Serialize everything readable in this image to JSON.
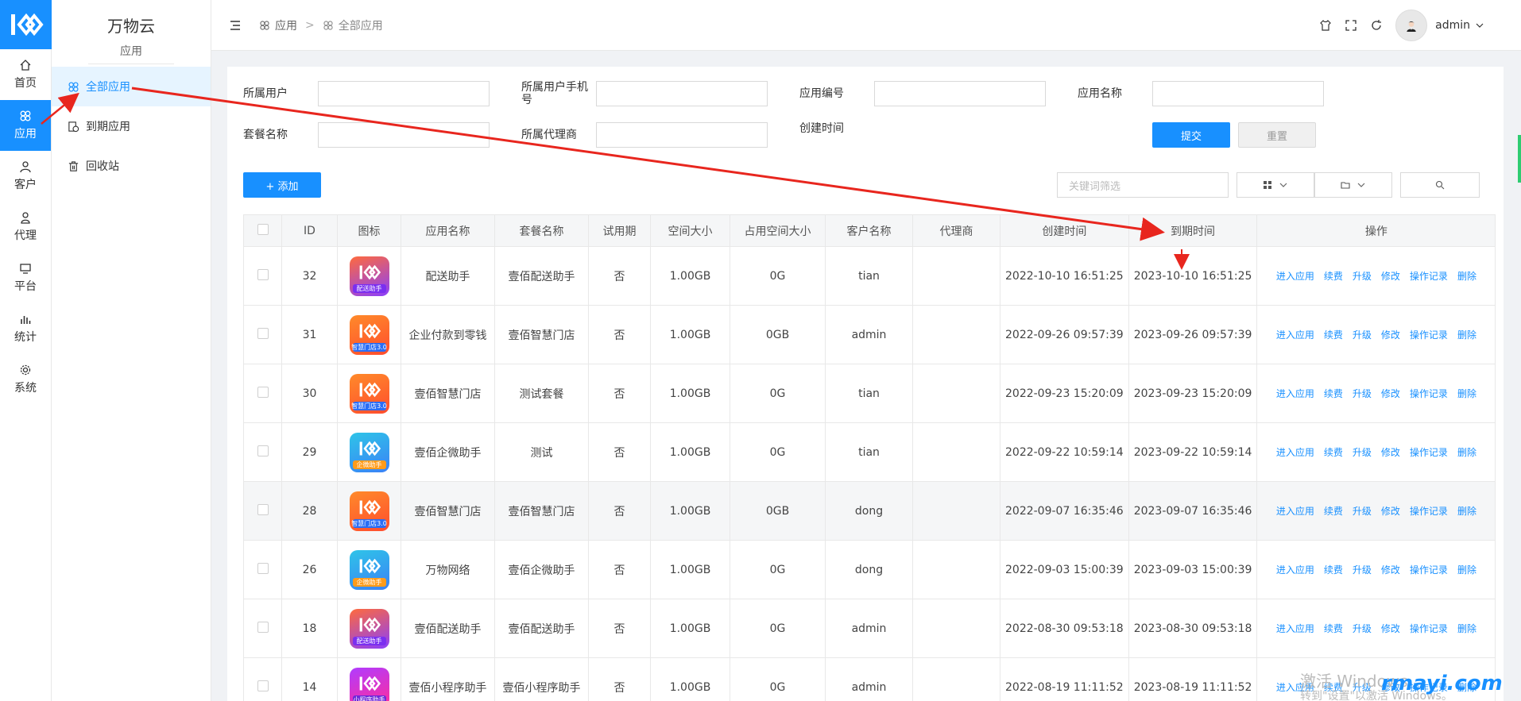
{
  "rail": {
    "items": [
      {
        "label": "首页",
        "icon": "home-icon"
      },
      {
        "label": "应用",
        "icon": "apps-icon"
      },
      {
        "label": "客户",
        "icon": "user-icon"
      },
      {
        "label": "代理",
        "icon": "agent-icon"
      },
      {
        "label": "平台",
        "icon": "platform-icon"
      },
      {
        "label": "统计",
        "icon": "stats-icon"
      },
      {
        "label": "系统",
        "icon": "gear-icon"
      }
    ],
    "active_index": 1
  },
  "submenu": {
    "brand": "万物云",
    "section": "应用",
    "items": [
      {
        "label": "全部应用",
        "icon": "apps-icon"
      },
      {
        "label": "到期应用",
        "icon": "expire-icon"
      },
      {
        "label": "回收站",
        "icon": "trash-icon"
      }
    ],
    "active_index": 0
  },
  "header": {
    "breadcrumb": [
      "应用",
      "全部应用"
    ],
    "separator": ">",
    "user": "admin"
  },
  "filters": {
    "fields": [
      "所属用户",
      "所属用户手机号",
      "应用编号",
      "应用名称",
      "套餐名称",
      "所属代理商",
      "创建时间"
    ],
    "submit_label": "提交",
    "reset_label": "重置"
  },
  "toolbar": {
    "add_label": "+ 添加",
    "search_placeholder": "关键词筛选"
  },
  "table": {
    "columns": [
      "ID",
      "图标",
      "应用名称",
      "套餐名称",
      "试用期",
      "空间大小",
      "占用空间大小",
      "客户名称",
      "代理商",
      "创建时间",
      "到期时间",
      "操作"
    ],
    "actions": [
      "进入应用",
      "续费",
      "升级",
      "修改",
      "操作记录",
      "删除"
    ],
    "rows": [
      {
        "id": "32",
        "icon_tag": "配送助手",
        "icon_color": "purple",
        "name": "配送助手",
        "plan": "壹佰配送助手",
        "trial": "否",
        "space": "1.00GB",
        "used": "0G",
        "customer": "tian",
        "agent": "",
        "created": "2022-10-10 16:51:25",
        "expires": "2023-10-10 16:51:25"
      },
      {
        "id": "31",
        "icon_tag": "智慧门店3.0",
        "icon_color": "orange",
        "name": "企业付款到零钱",
        "plan": "壹佰智慧门店",
        "trial": "否",
        "space": "1.00GB",
        "used": "0GB",
        "customer": "admin",
        "agent": "",
        "created": "2022-09-26 09:57:39",
        "expires": "2023-09-26 09:57:39"
      },
      {
        "id": "30",
        "icon_tag": "智慧门店3.0",
        "icon_color": "orange",
        "name": "壹佰智慧门店",
        "plan": "测试套餐",
        "trial": "否",
        "space": "1.00GB",
        "used": "0G",
        "customer": "tian",
        "agent": "",
        "created": "2022-09-23 15:20:09",
        "expires": "2023-09-23 15:20:09"
      },
      {
        "id": "29",
        "icon_tag": "企微助手",
        "icon_color": "teal",
        "name": "壹佰企微助手",
        "plan": "测试",
        "trial": "否",
        "space": "1.00GB",
        "used": "0G",
        "customer": "tian",
        "agent": "",
        "created": "2022-09-22 10:59:14",
        "expires": "2023-09-22 10:59:14"
      },
      {
        "id": "28",
        "icon_tag": "智慧门店3.0",
        "icon_color": "orange",
        "name": "壹佰智慧门店",
        "plan": "壹佰智慧门店",
        "trial": "否",
        "space": "1.00GB",
        "used": "0GB",
        "customer": "dong",
        "agent": "",
        "created": "2022-09-07 16:35:46",
        "expires": "2023-09-07 16:35:46"
      },
      {
        "id": "26",
        "icon_tag": "企微助手",
        "icon_color": "teal",
        "name": "万物网络",
        "plan": "壹佰企微助手",
        "trial": "否",
        "space": "1.00GB",
        "used": "0G",
        "customer": "dong",
        "agent": "",
        "created": "2022-09-03 15:00:39",
        "expires": "2023-09-03 15:00:39"
      },
      {
        "id": "18",
        "icon_tag": "配送助手",
        "icon_color": "purple",
        "name": "壹佰配送助手",
        "plan": "壹佰配送助手",
        "trial": "否",
        "space": "1.00GB",
        "used": "0G",
        "customer": "admin",
        "agent": "",
        "created": "2022-08-30 09:53:18",
        "expires": "2023-08-30 09:53:18"
      },
      {
        "id": "14",
        "icon_tag": "小程序助手",
        "icon_color": "magenta",
        "name": "壹佰小程序助手",
        "plan": "壹佰小程序助手",
        "trial": "否",
        "space": "1.00GB",
        "used": "0G",
        "customer": "admin",
        "agent": "",
        "created": "2022-08-19 11:11:52",
        "expires": "2023-08-19 11:11:52"
      }
    ],
    "highlighted_row_index": 4
  },
  "watermark": {
    "line1": "激活 Windows",
    "line2": "转到\"设置\"以激活 Windows。",
    "site": "rmayi.com"
  },
  "colors": {
    "primary": "#1890ff",
    "annotation": "#e8261e"
  }
}
